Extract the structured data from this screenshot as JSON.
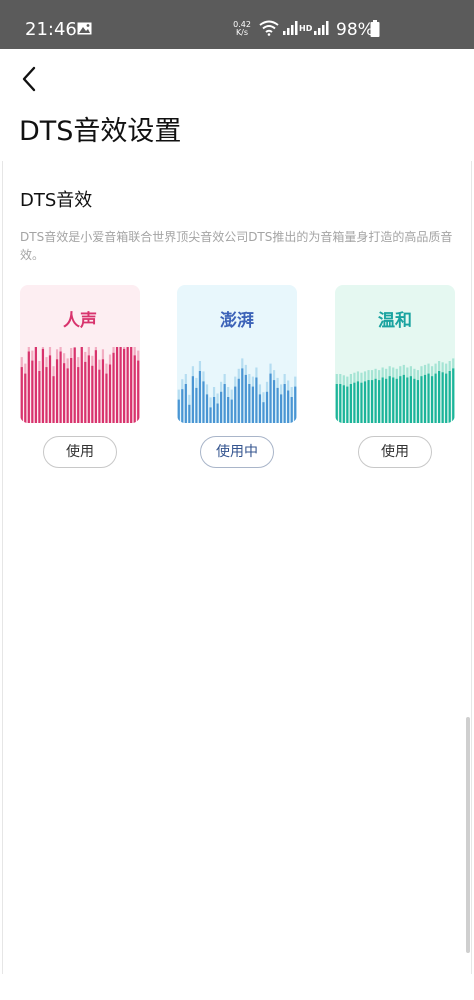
{
  "status_bar": {
    "time": "21:46",
    "speed_value": "0.42",
    "speed_unit": "K/s",
    "hd": "HD",
    "battery": "98%"
  },
  "header": {
    "title": "DTS音效设置"
  },
  "section": {
    "title": "DTS音效",
    "description": "DTS音效是小爱音箱联合世界顶尖音效公司DTS推出的为音箱量身打造的高品质音效。"
  },
  "effects": [
    {
      "name": "人声",
      "button_label": "使用",
      "selected": false,
      "colors": {
        "bg": "#fdeef2",
        "title": "#d8336d",
        "bar": "#d8336d",
        "bar_light": "#f2adc2"
      },
      "levels": [
        0.43,
        0.38,
        0.55,
        0.48,
        0.61,
        0.4,
        0.57,
        0.43,
        0.52,
        0.36,
        0.49,
        0.55,
        0.46,
        0.42,
        0.5,
        0.58,
        0.43,
        0.6,
        0.47,
        0.52,
        0.44,
        0.56,
        0.41,
        0.49,
        0.38,
        0.45,
        0.54,
        0.6,
        0.66,
        0.57,
        0.72,
        0.61,
        0.52,
        0.48
      ]
    },
    {
      "name": "澎湃",
      "button_label": "使用中",
      "selected": true,
      "colors": {
        "bg": "#e8f7fc",
        "title": "#3c63b8",
        "bar": "#4a95d3",
        "bar_light": "#b5ddf1"
      },
      "levels": [
        0.18,
        0.26,
        0.3,
        0.14,
        0.36,
        0.27,
        0.4,
        0.32,
        0.22,
        0.12,
        0.2,
        0.15,
        0.24,
        0.3,
        0.2,
        0.18,
        0.28,
        0.34,
        0.42,
        0.37,
        0.3,
        0.28,
        0.35,
        0.22,
        0.16,
        0.24,
        0.38,
        0.33,
        0.27,
        0.22,
        0.3,
        0.25,
        0.2,
        0.28
      ]
    },
    {
      "name": "温和",
      "button_label": "使用",
      "selected": false,
      "colors": {
        "bg": "#e5f8f1",
        "title": "#1aa3a0",
        "bar": "#1cb49a",
        "bar_light": "#a5e4d4"
      },
      "levels": [
        0.3,
        0.3,
        0.29,
        0.28,
        0.3,
        0.31,
        0.32,
        0.31,
        0.32,
        0.33,
        0.33,
        0.34,
        0.33,
        0.35,
        0.34,
        0.36,
        0.35,
        0.34,
        0.36,
        0.37,
        0.35,
        0.36,
        0.34,
        0.33,
        0.36,
        0.37,
        0.38,
        0.36,
        0.38,
        0.4,
        0.39,
        0.38,
        0.4,
        0.42
      ]
    }
  ]
}
